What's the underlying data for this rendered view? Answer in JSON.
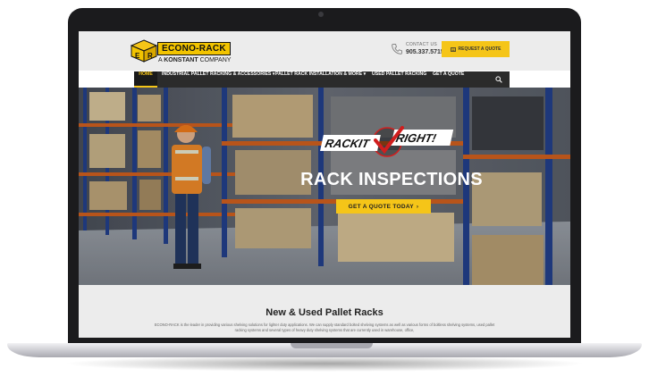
{
  "header": {
    "logo": {
      "name": "ECONO-RACK",
      "sub_prefix": "A",
      "sub_brand": "KONSTANT",
      "sub_suffix": "COMPANY",
      "cube_letters": [
        "E",
        "R"
      ]
    },
    "contact_label": "CONTACT US",
    "phone": "905.337.5715",
    "quote_button": "REQUEST A QUOTE"
  },
  "nav": {
    "items": [
      {
        "label": "HOME"
      },
      {
        "label": "INDUSTRIAL PALLET RACKING & ACCESSORIES",
        "caret": "▾"
      },
      {
        "label": "PALLET RACK INSTALLATION & MORE",
        "caret": "▾"
      },
      {
        "label": "USED PALLET RACKING"
      },
      {
        "label": "GET A QUOTE"
      }
    ]
  },
  "hero": {
    "badge_left": "RACKIT",
    "badge_right": "RIGHT!",
    "title": "RACK INSPECTIONS",
    "cta": "GET A QUOTE TODAY",
    "cta_arrow": "›"
  },
  "content": {
    "title": "New & Used Pallet Racks",
    "text": "ECONO-RACK is the leader in providing various shelving solutions for lighter duty applications. We can supply standard bolted shelving systems as well as various forms of boltless shelving systems, used pallet racking systems and several types of heavy duty shelving systems that are currently used in warehouse, office,"
  },
  "colors": {
    "accent": "#f5c518",
    "nav_bg": "#2b2b2b",
    "bezel": "#1b1b1d"
  },
  "icons": [
    "phone-icon",
    "document-icon",
    "search-icon",
    "cube-logo-icon"
  ]
}
